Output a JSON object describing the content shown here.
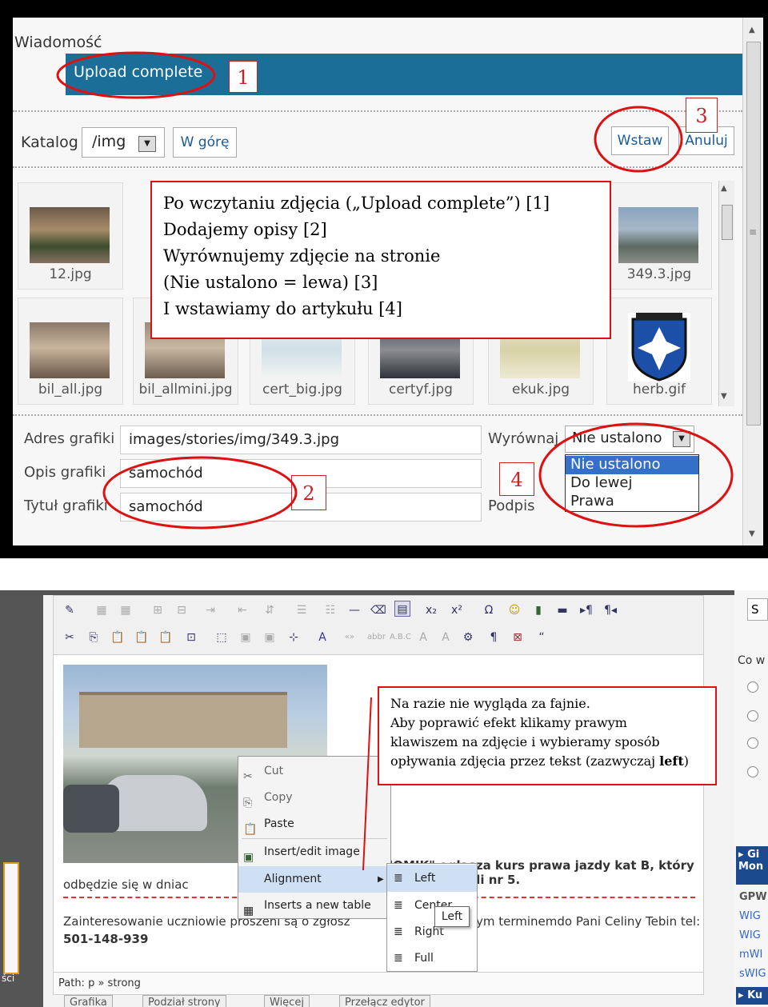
{
  "top": {
    "section_label": "Wiadomość",
    "upload_status": "Upload complete",
    "catalog_label": "Katalog",
    "catalog_value": "/img",
    "up_button": "W górę",
    "insert_button": "Wstaw",
    "cancel_button": "Anuluj",
    "thumbnails": [
      {
        "name": "12.jpg"
      },
      {
        "name": "349.3.jpg"
      },
      {
        "name": "bil_all.jpg"
      },
      {
        "name": "bil_allmini.jpg"
      },
      {
        "name": "cert_big.jpg"
      },
      {
        "name": "certyf.jpg"
      },
      {
        "name": "ekuk.jpg"
      },
      {
        "name": "herb.gif"
      }
    ],
    "fields": {
      "address_label": "Adres grafiki",
      "address_value": "images/stories/img/349.3.jpg",
      "desc_label": "Opis grafiki",
      "desc_value": "samochód",
      "title_label": "Tytuł grafiki",
      "title_value": "samochód",
      "align_label": "Wyrównaj",
      "align_value": "Nie ustalono",
      "caption_label": "Podpis",
      "align_options": [
        "Nie ustalono",
        "Do lewej",
        "Prawa"
      ]
    },
    "markers": [
      "1",
      "2",
      "3",
      "4"
    ],
    "note_lines": [
      "Po wczytaniu zdjęcia („Upload complete”) [1]",
      "Dodajemy opisy [2]",
      "Wyrównujemy zdjęcie na stronie",
      "(Nie ustalono = lewa) [3]",
      "I wstawiamy do artykułu [4]"
    ]
  },
  "bottom": {
    "context_menu": [
      "Cut",
      "Copy",
      "Paste",
      "Insert/edit image",
      "Alignment",
      "Inserts a new table"
    ],
    "alignment_submenu": [
      "Left",
      "Center",
      "Right",
      "Full"
    ],
    "tooltip": "Left",
    "editor_text": {
      "line1_a": "KONOMIK\" ogłasza kurs prawa jazdy kat B, który",
      "line2_a": "odbędzie się w dniac",
      "line2_b": "00  w sali nr 5.",
      "line3_a": "Zainteresowanie uczniowie proszeni są o zgłosz",
      "line3_b": "ym terminemdo Pani Celiny Tebin tel:",
      "line4": "501-148-939"
    },
    "path": "Path: p » strong",
    "bottom_buttons": [
      "Grafika",
      "Podział strony",
      "Więcej",
      "Przełącz edytor"
    ],
    "note_lines": [
      "Na razie nie wygląda za fajnie.",
      "Aby poprawić efekt klikamy prawym",
      "klawiszem na zdjęcie i wybieramy sposób",
      "opływania zdjęcia przez tekst (zazwyczaj "
    ],
    "note_bold": "left",
    "note_end": ")",
    "right_panel": [
      "S",
      "Co w",
      "Gi",
      "Mon",
      "GPW",
      "WIG",
      "WIG",
      "mWI",
      "sWIG",
      "Ku"
    ],
    "left_edge_text": "ści"
  }
}
